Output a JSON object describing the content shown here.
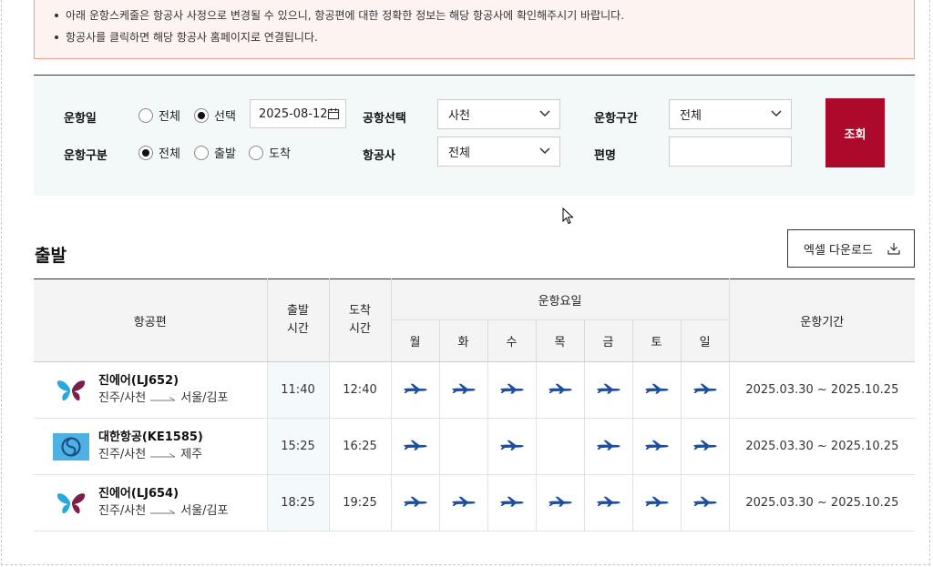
{
  "notice": {
    "items": [
      "아래 운항스케줄은 항공사 사정으로 변경될 수 있으니, 항공편에 대한 정확한 정보는 해당 항공사에 확인해주시기 바랍니다.",
      "항공사를 클릭하면 해당 항공사 홈페이지로 연결됩니다."
    ]
  },
  "search": {
    "date_label": "운항일",
    "date_options": [
      "전체",
      "선택"
    ],
    "date_selected": "선택",
    "date_value": "2025-08-12",
    "type_label": "운항구분",
    "type_options": [
      "전체",
      "출발",
      "도착"
    ],
    "type_selected": "전체",
    "airport_label": "공항선택",
    "airport_value": "사천",
    "airline_label": "항공사",
    "airline_value": "전체",
    "route_label": "운항구간",
    "route_value": "전체",
    "flight_no_label": "편명",
    "flight_no_value": "",
    "query_button": "조회"
  },
  "section_title": "출발",
  "excel_button": "엑셀 다운로드",
  "table": {
    "headers": {
      "flight": "항공편",
      "dep_time": "출발 시간",
      "arr_time": "도착 시간",
      "days": "운항요일",
      "period": "운항기간"
    },
    "day_names": [
      "월",
      "화",
      "수",
      "목",
      "금",
      "토",
      "일"
    ],
    "rows": [
      {
        "airline": "진에어(LJ652)",
        "logo": "jinair-butterfly-logo",
        "from": "진주/사천",
        "to": "서울/김포",
        "dep": "11:40",
        "arr": "12:40",
        "days": [
          true,
          true,
          true,
          true,
          true,
          true,
          true
        ],
        "period": "2025.03.30 ~ 2025.10.25"
      },
      {
        "airline": "대한항공(KE1585)",
        "logo": "koreanair-taeguk-logo",
        "from": "진주/사천",
        "to": "제주",
        "dep": "15:25",
        "arr": "16:25",
        "days": [
          true,
          false,
          true,
          false,
          true,
          true,
          true
        ],
        "period": "2025.03.30 ~ 2025.10.25"
      },
      {
        "airline": "진에어(LJ654)",
        "logo": "jinair-butterfly-logo",
        "from": "진주/사천",
        "to": "서울/김포",
        "dep": "18:25",
        "arr": "19:25",
        "days": [
          true,
          true,
          true,
          true,
          true,
          true,
          true
        ],
        "period": "2025.03.30 ~ 2025.10.25"
      }
    ]
  },
  "colors": {
    "accent": "#ad0a2b",
    "plane": "#1a4ea0",
    "notice_bg": "#fdf3f1",
    "notice_border": "#e9a08c",
    "search_bg": "#f3f9f9"
  }
}
